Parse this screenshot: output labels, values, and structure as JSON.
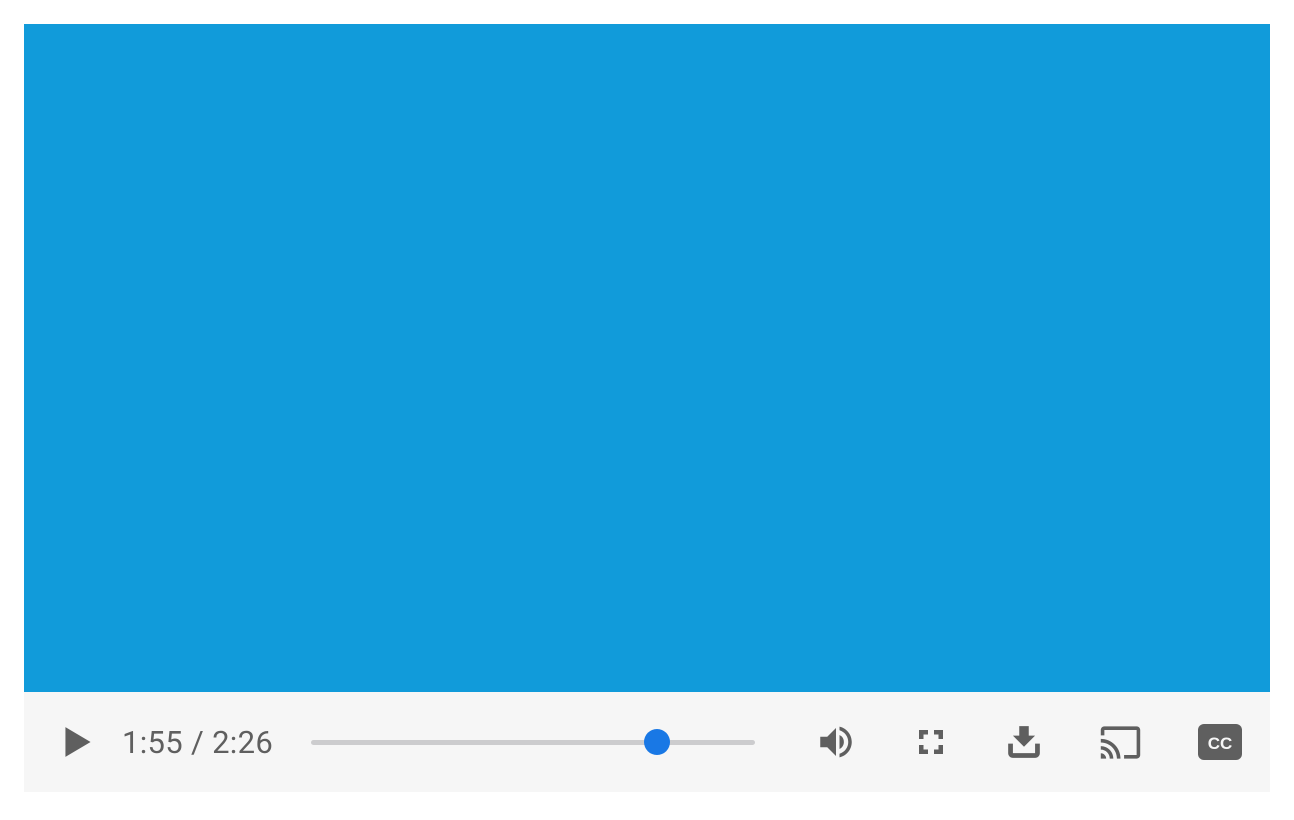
{
  "player": {
    "current_time": "1:55",
    "duration": "2:26",
    "time_separator": " / ",
    "progress_percent": 78,
    "colors": {
      "video_bg": "#119bda",
      "icon": "#5f5f5f",
      "thumb": "#1978e5",
      "track": "#ccccce",
      "controls_bg": "#f6f6f6"
    },
    "captions_label": "CC"
  }
}
